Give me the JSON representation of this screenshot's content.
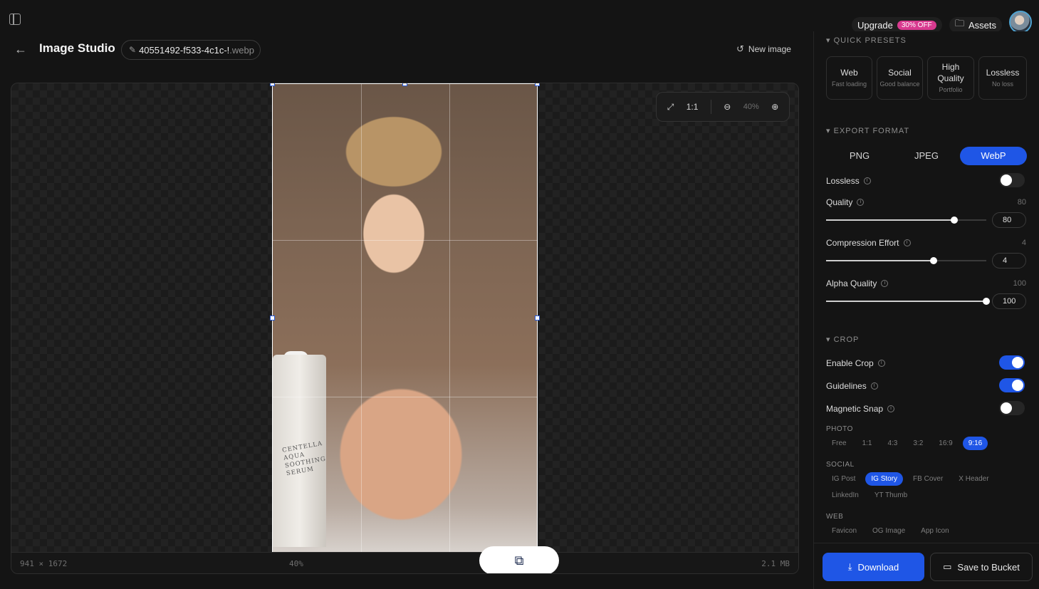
{
  "header": {
    "title": "Image Studio",
    "file_name": "40551492-f533-4c1c-!",
    "file_ext": ".webp",
    "new_image_label": "New image",
    "upgrade_label": "Upgrade",
    "upgrade_badge": "30% OFF",
    "assets_label": "Assets"
  },
  "canvas": {
    "fit_icon": "expand-icon",
    "ratio_label": "1:1",
    "zoom_level": "40%",
    "bottle_label": "CENTELLA AQUA SOOTHING SERUM",
    "status_dimensions": "941 × 1672",
    "status_zoom": "40%",
    "status_size": "2.1 MB"
  },
  "panel": {
    "quick_presets": {
      "heading": "▾ QUICK PRESETS",
      "items": [
        {
          "title": "Web",
          "sub": "Fast loading"
        },
        {
          "title": "Social",
          "sub": "Good balance"
        },
        {
          "title": "High Quality",
          "sub": "Portfolio"
        },
        {
          "title": "Lossless",
          "sub": "No loss"
        }
      ]
    },
    "export_format": {
      "heading": "▾ EXPORT FORMAT",
      "formats": [
        "PNG",
        "JPEG",
        "WebP"
      ],
      "active": "WebP",
      "lossless_label": "Lossless",
      "lossless_on": false,
      "quality_label": "Quality",
      "quality_value": "80",
      "quality_fraction": 0.8,
      "effort_label": "Compression Effort",
      "effort_value": "4",
      "effort_fraction": 0.67,
      "alpha_label": "Alpha Quality",
      "alpha_value": "100",
      "alpha_fraction": 1.0
    },
    "crop": {
      "heading": "▾ CROP",
      "enable_label": "Enable Crop",
      "enable_on": true,
      "guidelines_label": "Guidelines",
      "guidelines_on": true,
      "snap_label": "Magnetic Snap",
      "snap_on": false,
      "photo_heading": "PHOTO",
      "photo_ratios": [
        "Free",
        "1:1",
        "4:3",
        "3:2",
        "16:9",
        "9:16"
      ],
      "photo_active": "9:16",
      "social_heading": "SOCIAL",
      "social_ratios": [
        "IG Post",
        "IG Story",
        "FB Cover",
        "X Header",
        "LinkedIn",
        "YT Thumb"
      ],
      "social_active": "IG Story",
      "web_heading": "WEB",
      "web_ratios": [
        "Favicon",
        "OG Image",
        "App Icon"
      ]
    },
    "download_label": "Download",
    "bucket_label": "Save to Bucket"
  },
  "colors": {
    "accent": "#1f56e6",
    "badge": "#d83a8f",
    "background": "#141414"
  }
}
